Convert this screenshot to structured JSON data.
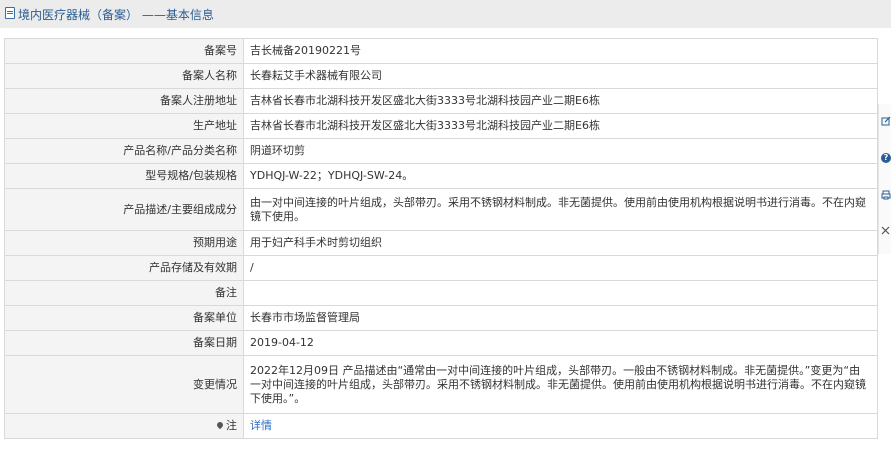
{
  "header": {
    "title": "境内医疗器械（备案） ——基本信息"
  },
  "rows": [
    {
      "label": "备案号",
      "value": "吉长械备20190221号"
    },
    {
      "label": "备案人名称",
      "value": "长春耘艾手术器械有限公司"
    },
    {
      "label": "备案人注册地址",
      "value": "吉林省长春市北湖科技开发区盛北大街3333号北湖科技园产业二期E6栋"
    },
    {
      "label": "生产地址",
      "value": "吉林省长春市北湖科技开发区盛北大街3333号北湖科技园产业二期E6栋"
    },
    {
      "label": "产品名称/产品分类名称",
      "value": "阴道环切剪"
    },
    {
      "label": "型号规格/包装规格",
      "value": "YDHQJ-W-22；YDHQJ-SW-24。"
    },
    {
      "label": "产品描述/主要组成成分",
      "value": "由一对中间连接的叶片组成，头部带刃。采用不锈钢材料制成。非无菌提供。使用前由使用机构根据说明书进行消毒。不在内窥镜下使用。"
    },
    {
      "label": "预期用途",
      "value": "用于妇产科手术时剪切组织"
    },
    {
      "label": "产品存储及有效期",
      "value": "/"
    },
    {
      "label": "备注",
      "value": ""
    },
    {
      "label": "备案单位",
      "value": "长春市市场监督管理局"
    },
    {
      "label": "备案日期",
      "value": "2019-04-12"
    },
    {
      "label": "变更情况",
      "value": "2022年12月09日 产品描述由“通常由一对中间连接的叶片组成，头部带刃。一般由不锈钢材料制成。非无菌提供。”变更为“由一对中间连接的叶片组成，头部带刃。采用不锈钢材料制成。非无菌提供。使用前由使用机构根据说明书进行消毒。不在内窥镜下使用。”。"
    }
  ],
  "note": {
    "label": "注",
    "link": "详情"
  },
  "side_toolbar": {
    "icons": [
      "edit-icon",
      "help-icon",
      "print-icon",
      "close-icon"
    ],
    "help_glyph": "?"
  }
}
